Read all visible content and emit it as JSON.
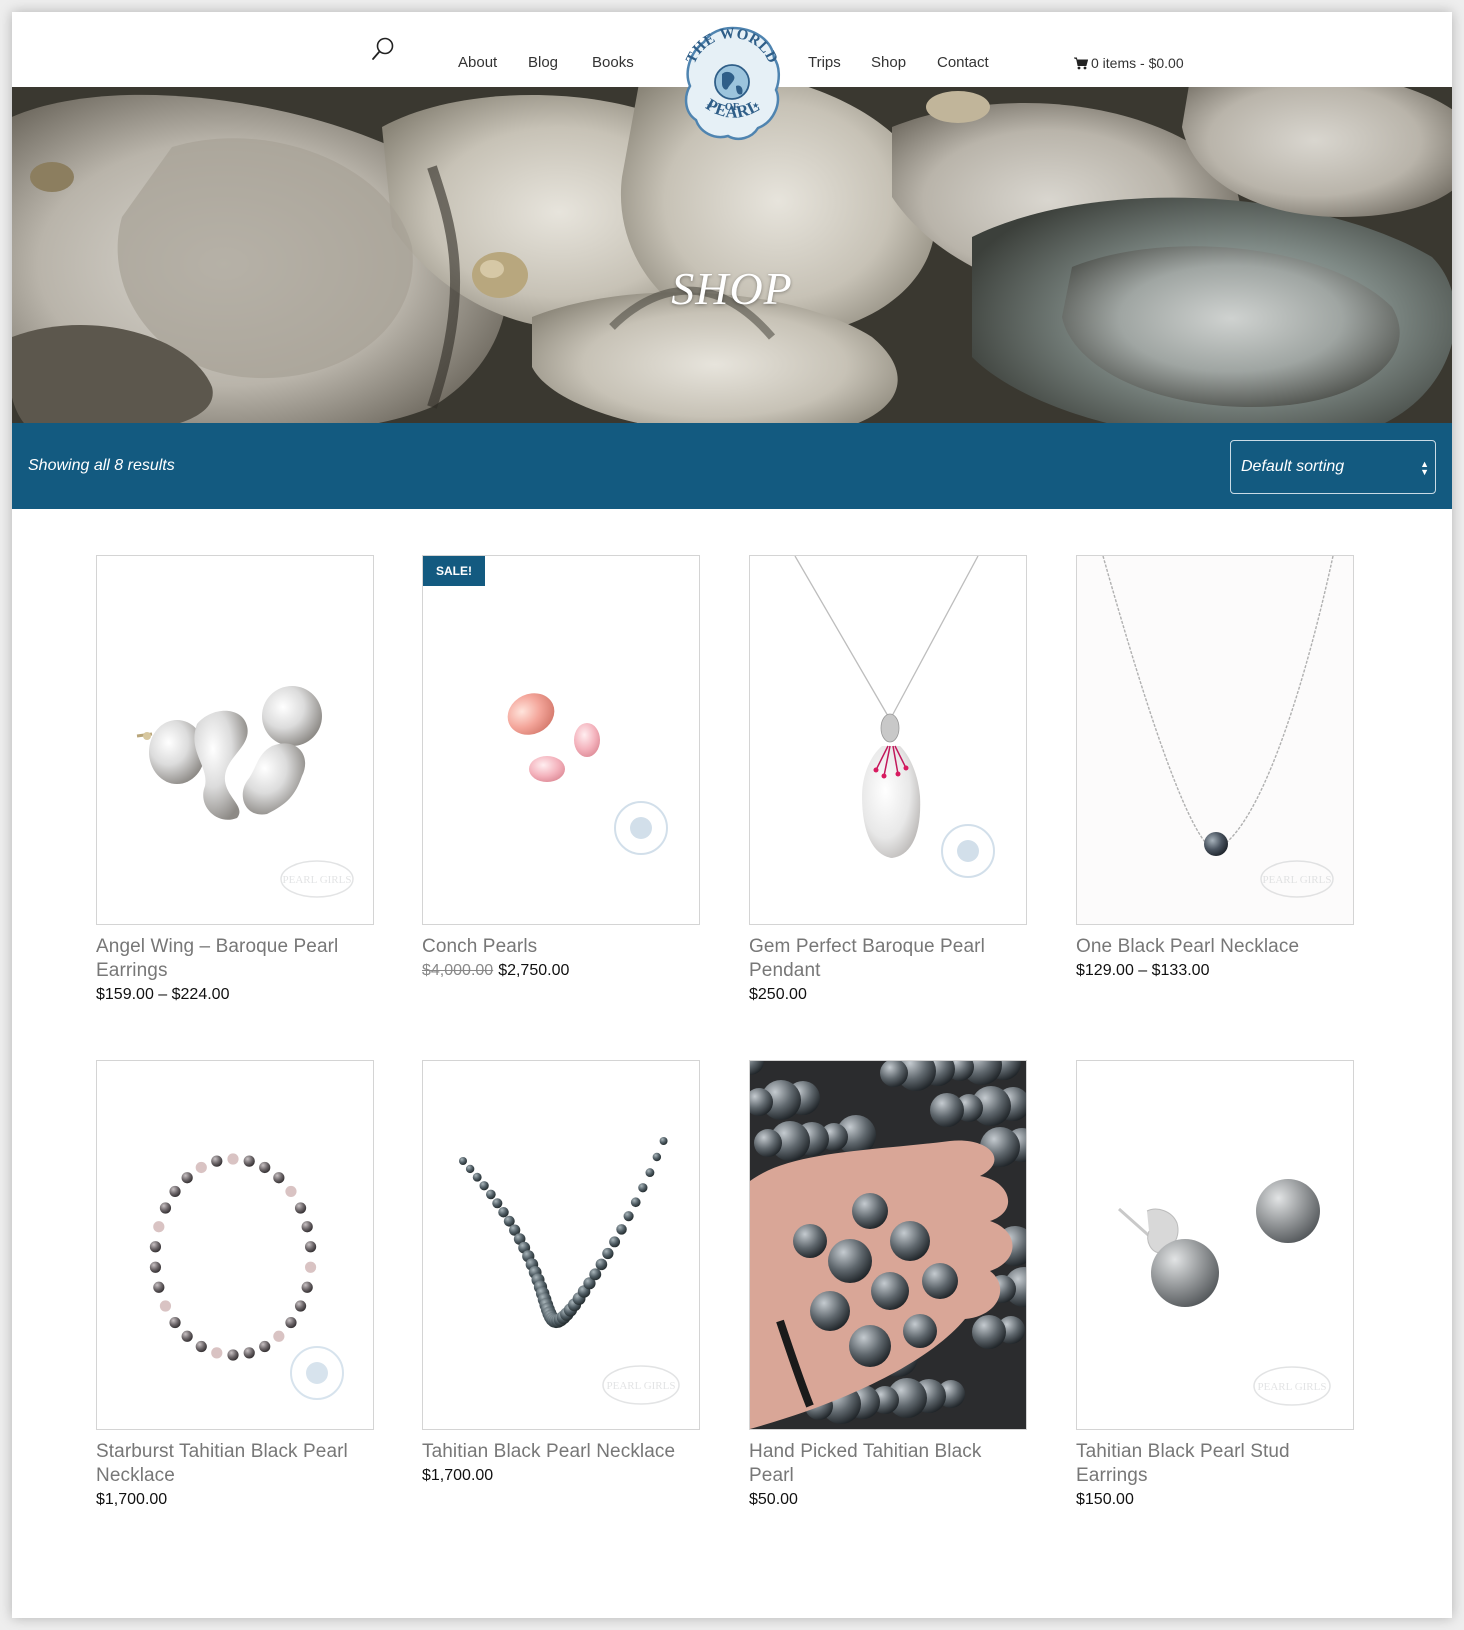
{
  "nav": {
    "left_links": [
      "About",
      "Blog",
      "Books"
    ],
    "right_links": [
      "Trips",
      "Shop",
      "Contact"
    ],
    "cart_label": "0 items - $0.00",
    "logo": {
      "line1": "THE WORLD",
      "line2": "OF",
      "line3": "PEARL"
    }
  },
  "hero": {
    "title": "SHOP"
  },
  "toolbar": {
    "result_count": "Showing all 8 results",
    "sort_selected": "Default sorting"
  },
  "products": [
    {
      "title": "Angel Wing – Baroque Pearl Earrings",
      "price": "$159.00 – $224.00",
      "watermark": "PEARL GIRLS"
    },
    {
      "title": "Conch Pearls",
      "old_price": "$4,000.00",
      "price": "$2,750.00",
      "badge": "SALE!",
      "watermark": "THE WORLD OF PEARL"
    },
    {
      "title": "Gem Perfect Baroque Pearl Pendant",
      "price": "$250.00",
      "watermark": "THE WORLD OF PEARL"
    },
    {
      "title": "One Black Pearl Necklace",
      "price": "$129.00 – $133.00",
      "watermark": "PEARL GIRLS"
    },
    {
      "title": "Starburst Tahitian Black Pearl Necklace",
      "price": "$1,700.00",
      "watermark": "THE WORLD OF PEARL"
    },
    {
      "title": "Tahitian Black Pearl Necklace",
      "price": "$1,700.00",
      "watermark": "PEARL GIRLS"
    },
    {
      "title": "Hand Picked Tahitian Black Pearl",
      "price": "$50.00"
    },
    {
      "title": "Tahitian Black Pearl Stud Earrings",
      "price": "$150.00",
      "watermark": "PEARL GIRLS"
    }
  ],
  "colors": {
    "brand_blue": "#135a80",
    "title_gray": "#777777"
  }
}
